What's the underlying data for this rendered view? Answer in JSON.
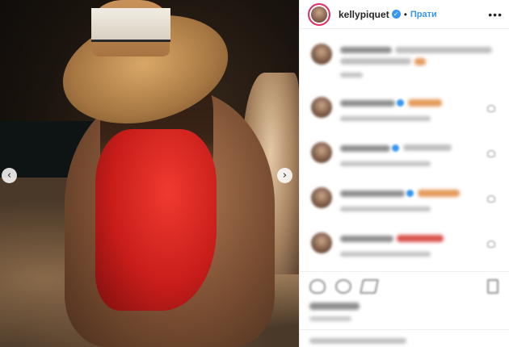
{
  "post": {
    "username": "kellypiquet",
    "follow_label": "Прати",
    "separator": "•",
    "more_label": "•••",
    "verified_icon": "✓"
  },
  "carousel": {
    "prev_label": "‹",
    "next_label": "›"
  },
  "icons": {
    "verified": "verified-badge-icon",
    "more": "more-options-icon",
    "like": "heart-icon",
    "comment": "comment-icon",
    "share": "share-icon",
    "save": "bookmark-icon"
  },
  "colors": {
    "link_blue": "#3897f0",
    "swimsuit_red": "#d8221d",
    "text": "#262626",
    "muted": "#8e8e8e"
  }
}
